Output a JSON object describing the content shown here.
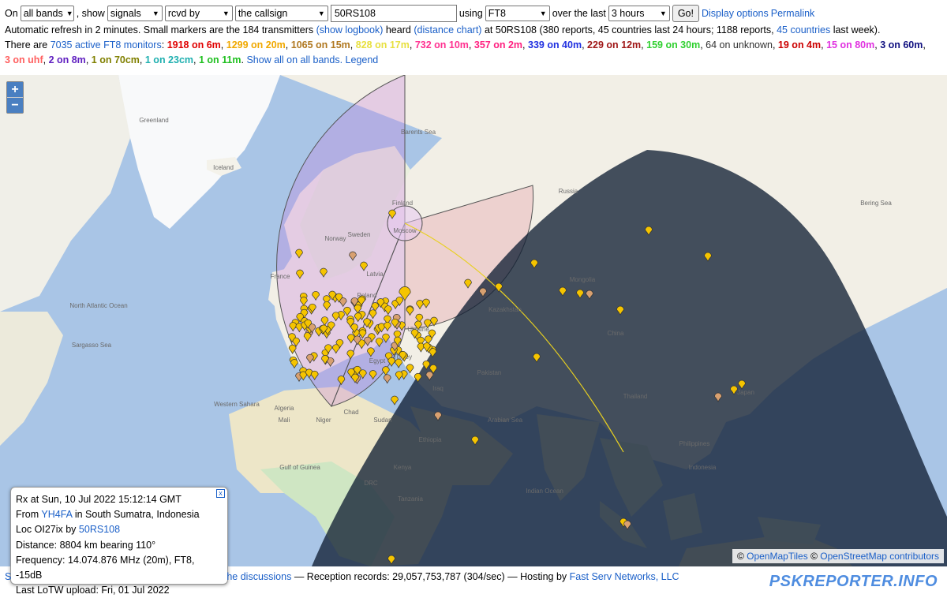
{
  "controls": {
    "on_label": "On",
    "bands_value": "all bands",
    "show_label": ", show",
    "signals_value": "signals",
    "rcvd_value": "rcvd by",
    "callsign_mode_value": "the callsign",
    "callsign_input": "50RS108",
    "using_label": "using",
    "mode_value": "FT8",
    "over_label": "over the last",
    "period_value": "3 hours",
    "go_label": "Go!",
    "display_options": "Display options",
    "permalink": "Permalink"
  },
  "info": {
    "refresh_text": "Automatic refresh in 2 minutes. Small markers are the 184 transmitters",
    "show_logbook": "(show logbook)",
    "heard_text": "heard",
    "distance_chart": "(distance chart)",
    "stats_text": "at 50RS108 (380 reports, 45 countries last 24 hours; 1188 reports,",
    "countries_link": "45 countries",
    "last_week": "last week).",
    "there_are": "There are",
    "active_monitors": "7035 active FT8 monitors",
    "colon": ":",
    "bands": [
      {
        "text": "1918 on 6m",
        "color": "#e00000"
      },
      {
        "text": "1299 on 20m",
        "color": "#f0a800"
      },
      {
        "text": "1065 on 15m",
        "color": "#b07820"
      },
      {
        "text": "828 on 17m",
        "color": "#e8e040"
      },
      {
        "text": "732 on 10m",
        "color": "#ff3090"
      },
      {
        "text": "357 on 2m",
        "color": "#ff2080"
      },
      {
        "text": "339 on 40m",
        "color": "#2030e0"
      },
      {
        "text": "229 on 12m",
        "color": "#a01818"
      },
      {
        "text": "159 on 30m",
        "color": "#30d030"
      },
      {
        "text": "64 on unknown",
        "color": "#303030",
        "plain": true
      },
      {
        "text": "19 on 4m",
        "color": "#cc0000"
      },
      {
        "text": "15 on 80m",
        "color": "#e030e0"
      },
      {
        "text": "3 on 60m",
        "color": "#101080"
      },
      {
        "text": "3 on uhf",
        "color": "#ff6060"
      },
      {
        "text": "2 on 8m",
        "color": "#6020c0"
      },
      {
        "text": "1 on 70cm",
        "color": "#808000"
      },
      {
        "text": "1 on 23cm",
        "color": "#20b0b0"
      },
      {
        "text": "1 on 11m",
        "color": "#20c020"
      }
    ],
    "show_all": "Show all on all bands.",
    "legend": "Legend"
  },
  "map": {
    "zoom_in": "+",
    "zoom_out": "−",
    "labels": [
      {
        "text": "Greenland"
      },
      {
        "text": "Iceland"
      },
      {
        "text": "Norway"
      },
      {
        "text": "Sweden"
      },
      {
        "text": "Finland"
      },
      {
        "text": "Latvia"
      },
      {
        "text": "Poland"
      },
      {
        "text": "France"
      },
      {
        "text": "Ukraine"
      },
      {
        "text": "Moscow"
      },
      {
        "text": "Kazakhstan"
      },
      {
        "text": "Turkey"
      },
      {
        "text": "Mongolia"
      },
      {
        "text": "Egypt"
      },
      {
        "text": "Algeria"
      },
      {
        "text": "Sudan"
      },
      {
        "text": "Russia"
      },
      {
        "text": "China"
      },
      {
        "text": "Barents Sea"
      },
      {
        "text": "Bering Sea"
      },
      {
        "text": "North Atlantic Ocean"
      },
      {
        "text": "Sargasso Sea"
      },
      {
        "text": "Indian Ocean"
      },
      {
        "text": "Arabian Sea"
      },
      {
        "text": "Gulf of Guinea"
      },
      {
        "text": "Pakistan"
      },
      {
        "text": "Iraq"
      },
      {
        "text": "Chad"
      },
      {
        "text": "Niger"
      },
      {
        "text": "Mali"
      },
      {
        "text": "DRC"
      },
      {
        "text": "Kenya"
      },
      {
        "text": "Tanzania"
      },
      {
        "text": "Ethiopia"
      },
      {
        "text": "Thailand"
      },
      {
        "text": "Indonesia"
      },
      {
        "text": "Japan"
      },
      {
        "text": "Philippines"
      },
      {
        "text": "Western Sahara"
      }
    ],
    "attribution_prefix": "©",
    "openmaptiles": "OpenMapTiles",
    "osm": "OpenStreetMap contributors"
  },
  "popup": {
    "rx_line": "Rx at Sun, 10 Jul 2022 15:12:14 GMT",
    "from_label": "From",
    "from_call": "YH4FA",
    "from_place": "in South Sumatra, Indonesia",
    "loc_label": "Loc OI27ix by",
    "loc_call": "50RS108",
    "distance": "Distance: 8804 km bearing 110°",
    "frequency": "Frequency: 14.074.876 MHz (20m), FT8, -15dB",
    "lotw": "Last LoTW upload: Fri, 01 Jul 2022",
    "close": "x"
  },
  "footer": {
    "prefix": "S",
    "discussions": "he discussions",
    "records": "— Reception records: 29,057,753,787 (304/sec) — Hosting by",
    "hosting": "Fast Serv Networks, LLC",
    "brand": "PSKREPORTER.INFO"
  },
  "colors": {
    "ocean": "#a9c5e6",
    "land": "#f2efe6",
    "ice": "#f8f9fa",
    "green": "#cfe6c3",
    "night": "#142434",
    "marker": "#f5c400",
    "marker_alt": "#d8a070"
  }
}
